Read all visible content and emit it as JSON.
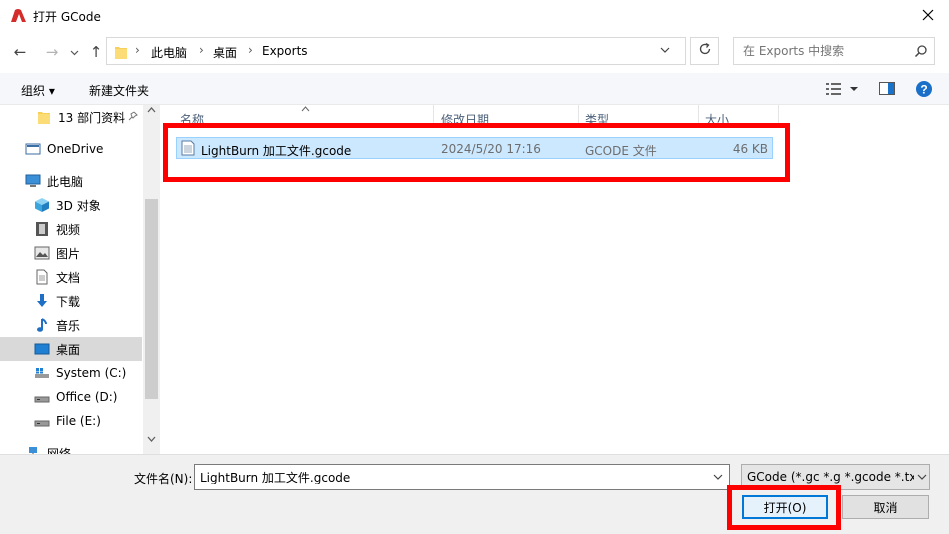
{
  "window": {
    "title": "打开 GCode",
    "icons": {
      "app": "lightburn-app-icon",
      "close": "close-icon"
    }
  },
  "nav_buttons": {
    "back": "←",
    "forward": "→",
    "recent": "⌄",
    "up": "↑"
  },
  "address": {
    "breadcrumbs": [
      "此电脑",
      "桌面",
      "Exports"
    ],
    "separator": "›"
  },
  "search": {
    "placeholder": "在 Exports 中搜索"
  },
  "toolbar": {
    "organize": "组织 ▾",
    "new_folder": "新建文件夹"
  },
  "nav_pane": {
    "items": [
      {
        "label": "13 部门资料",
        "icon": "folder-icon"
      },
      {
        "label": "OneDrive",
        "icon": "onedrive-icon"
      },
      {
        "label": "此电脑",
        "icon": "computer-icon"
      },
      {
        "label": "3D 对象",
        "icon": "cube-icon"
      },
      {
        "label": "视频",
        "icon": "video-icon"
      },
      {
        "label": "图片",
        "icon": "pictures-icon"
      },
      {
        "label": "文档",
        "icon": "documents-icon"
      },
      {
        "label": "下载",
        "icon": "download-icon"
      },
      {
        "label": "音乐",
        "icon": "music-icon"
      },
      {
        "label": "桌面",
        "icon": "desktop-icon",
        "selected": true
      },
      {
        "label": "System (C:)",
        "icon": "drive-c-icon"
      },
      {
        "label": "Office (D:)",
        "icon": "drive-icon"
      },
      {
        "label": "File (E:)",
        "icon": "drive-icon"
      },
      {
        "label": "网络",
        "icon": "network-icon"
      }
    ]
  },
  "file_list": {
    "columns": [
      "名称",
      "修改日期",
      "类型",
      "大小"
    ],
    "rows": [
      {
        "name": "LightBurn 加工文件.gcode",
        "modified": "2024/5/20 17:16",
        "type": "GCODE 文件",
        "size": "46 KB",
        "selected": true
      }
    ]
  },
  "bottom": {
    "filename_label": "文件名(N):",
    "filename_value": "LightBurn 加工文件.gcode",
    "filetype": "GCode (*.gc *.g *.gcode *.txt",
    "open_label": "打开(O)",
    "cancel_label": "取消"
  },
  "colors": {
    "selection": "#cce8ff",
    "annotation": "#ff0000",
    "accent": "#0078d7"
  }
}
